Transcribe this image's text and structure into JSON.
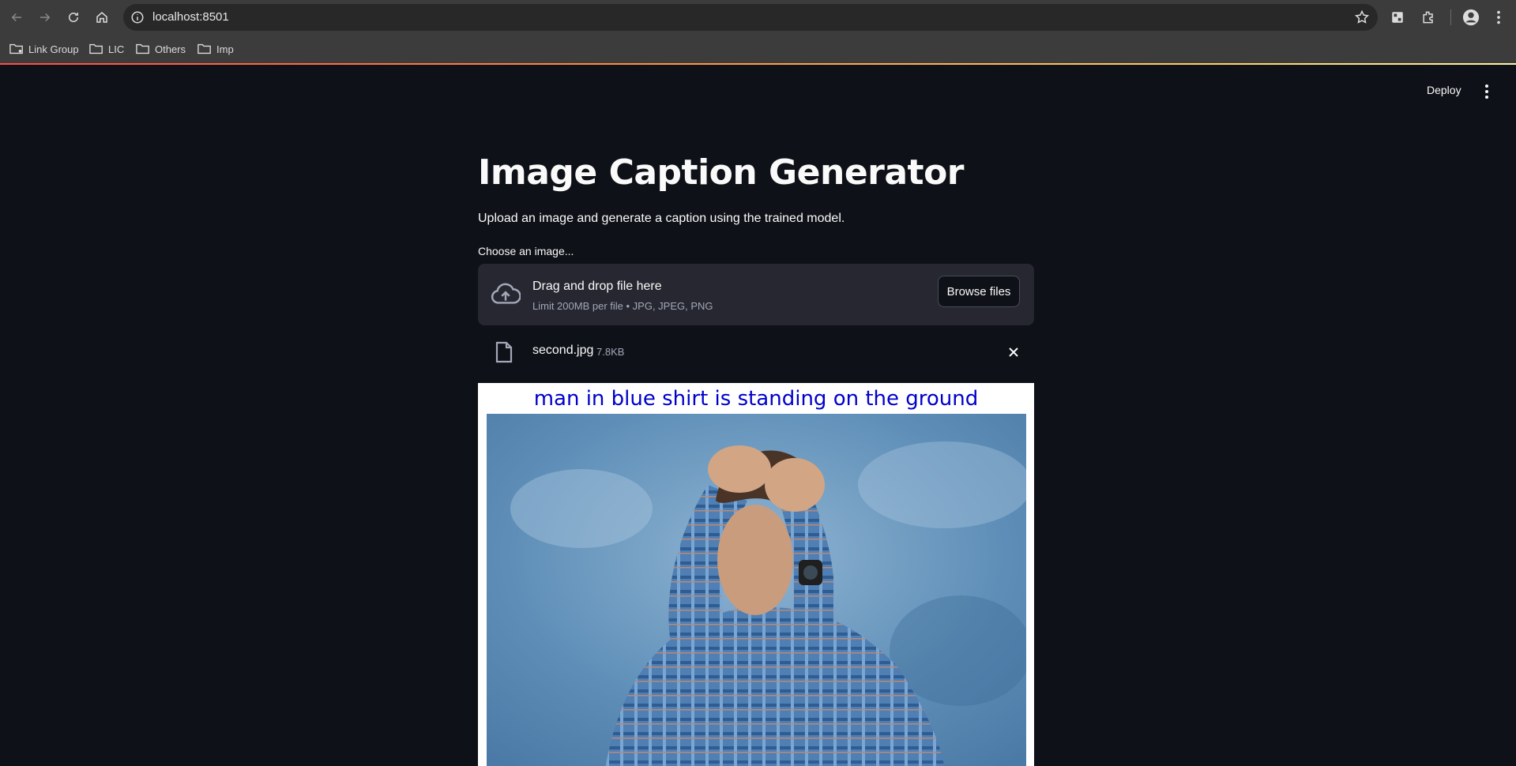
{
  "browser": {
    "url": "localhost:8501",
    "bookmarks": [
      "Link Group",
      "LIC",
      "Others",
      "Imp"
    ]
  },
  "header": {
    "deploy_label": "Deploy"
  },
  "main": {
    "title": "Image Caption Generator",
    "subtitle": "Upload an image and generate a caption using the trained model.",
    "uploader_label": "Choose an image...",
    "dropzone_title": "Drag and drop file here",
    "dropzone_limit": "Limit 200MB per file • JPG, JPEG, PNG",
    "browse_label": "Browse files",
    "file_name": "second.jpg",
    "file_size": "7.8KB",
    "caption": "man in blue shirt is standing on the ground"
  },
  "colors": {
    "app_background": "#0e1117",
    "caption_text": "#0000cc",
    "dropzone_bg": "#262730"
  },
  "icons": [
    "back-icon",
    "forward-icon",
    "reload-icon",
    "home-icon",
    "info-icon",
    "star-icon",
    "extension-icon",
    "profile-icon",
    "cloud-upload-icon",
    "file-icon",
    "close-icon",
    "kebab-menu-icon",
    "folder-icon"
  ]
}
